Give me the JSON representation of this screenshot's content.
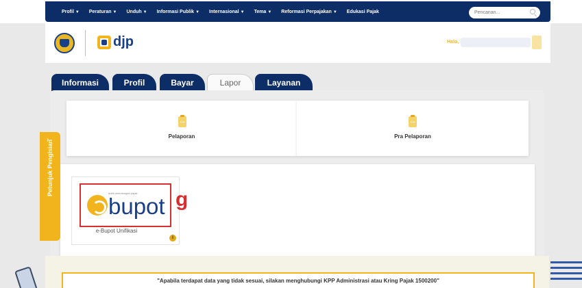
{
  "nav": {
    "items": [
      {
        "label": "Profil",
        "caret": true
      },
      {
        "label": "Peraturan",
        "caret": true
      },
      {
        "label": "Unduh",
        "caret": true
      },
      {
        "label": "Informasi Publik",
        "caret": true
      },
      {
        "label": "Internasional",
        "caret": true
      },
      {
        "label": "Tema",
        "caret": true
      },
      {
        "label": "Reformasi Perpajakan",
        "caret": true
      },
      {
        "label": "Edukasi Pajak",
        "caret": false
      }
    ],
    "search_placeholder": "Pencarian..."
  },
  "header": {
    "logo_text": "djp",
    "greeting": "Halo,"
  },
  "tabs": [
    {
      "label": "Informasi",
      "active": false
    },
    {
      "label": "Profil",
      "active": false
    },
    {
      "label": "Bayar",
      "active": false
    },
    {
      "label": "Lapor",
      "active": true
    },
    {
      "label": "Layanan",
      "active": false
    }
  ],
  "service_cards": [
    {
      "label": "Pelaporan"
    },
    {
      "label": "Pra Pelaporan"
    }
  ],
  "app": {
    "logo_text": "bupot",
    "logo_subtext": "bukti pemotongan pajak",
    "annotation": "g",
    "label": "e-Bupot Unifikasi",
    "info_glyph": "i"
  },
  "side_tab": {
    "label": "Petunjuk Pengisian",
    "chevron": "›"
  },
  "notice": {
    "text": "\"Apabila terdapat data yang tidak sesuai, silakan menghubungi KPP Administrasi atau Kring Pajak 1500200\""
  },
  "colors": {
    "navy": "#0d2d67",
    "gold": "#f2b41c",
    "highlight_red": "#d62f2f"
  }
}
